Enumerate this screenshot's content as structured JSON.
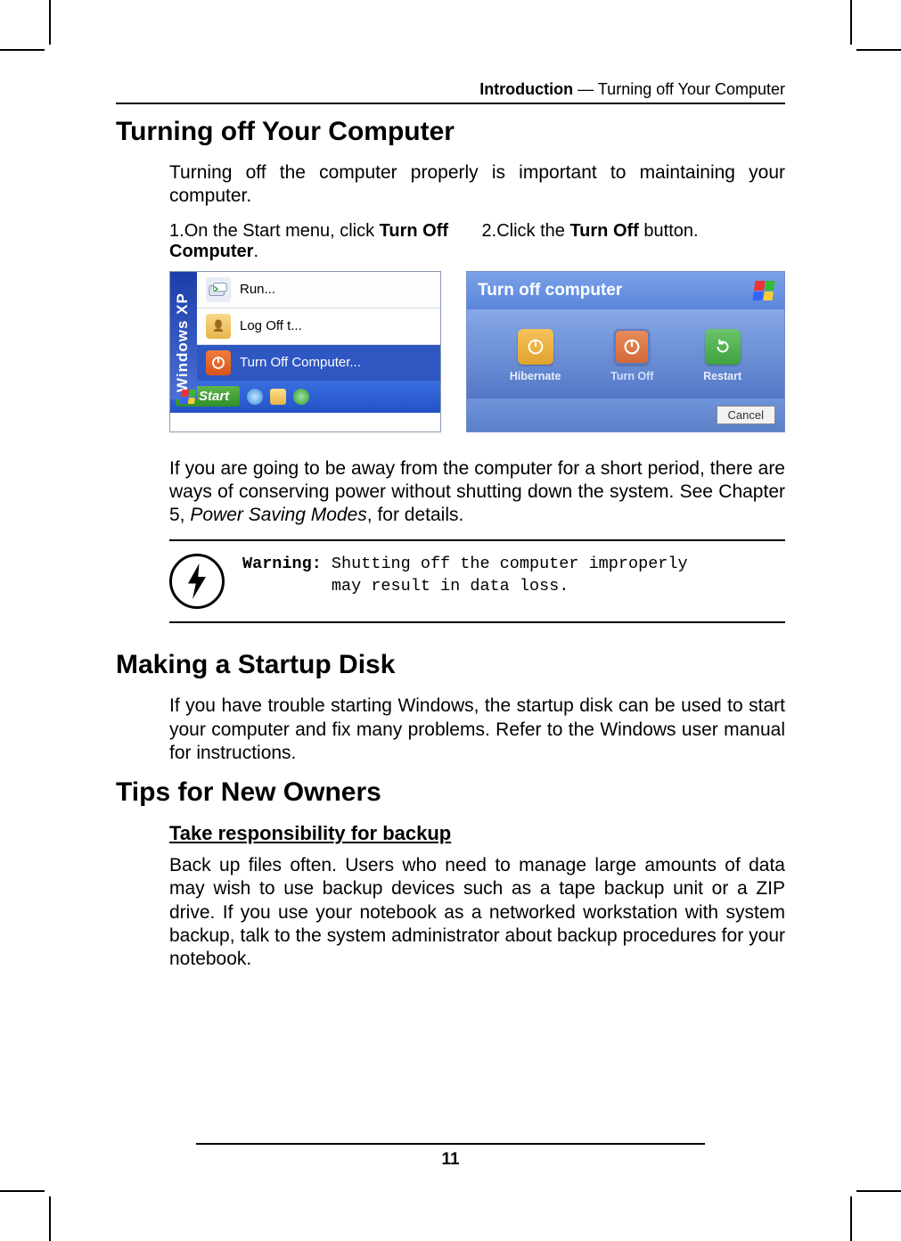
{
  "running_head": {
    "bold": "Introduction",
    "sep": " — ",
    "rest": "Turning off Your Computer"
  },
  "h_turnoff": "Turning off Your Computer",
  "p_turnoff": "Turning off the computer properly is important to maintaining your computer.",
  "step1": {
    "num": "1.",
    "pre": "On the Start menu, click ",
    "bold": "Turn Off Computer",
    "post": "."
  },
  "step2": {
    "num": "2.",
    "pre": "Click the ",
    "bold": "Turn Off",
    "post": " button."
  },
  "startmenu": {
    "rail": "Windows XP",
    "run": "Run...",
    "logoff": "Log Off t...",
    "turnoff": "Turn Off Computer...",
    "start": "Start"
  },
  "dialog": {
    "title": "Turn off computer",
    "hibernate": "Hibernate",
    "turnoff": "Turn Off",
    "restart": "Restart",
    "cancel": "Cancel"
  },
  "p_away_1": "If you are going to be away from the computer for a short period, there are ways of conserving power without shutting down the system. See Chapter 5, ",
  "p_away_italic": "Power Saving Modes",
  "p_away_2": ", for details.",
  "warning": {
    "label": "Warning:",
    "l1": " Shutting off the computer improperly",
    "l2": "         may result in data loss."
  },
  "h_startup": "Making a Startup Disk",
  "p_startup": "If you have trouble starting Windows, the startup disk can be used to start your computer and fix many problems. Refer to the Windows user manual for instructions.",
  "h_tips": "Tips for New Owners",
  "sub_backup": "Take responsibility for backup",
  "p_backup": "Back up files often. Users who need to manage large amounts of data may wish to use backup devices such as a tape backup unit or a ZIP drive. If you use your notebook as a networked workstation with system backup, talk to the system administrator about backup procedures for your notebook.",
  "page_number": "11"
}
